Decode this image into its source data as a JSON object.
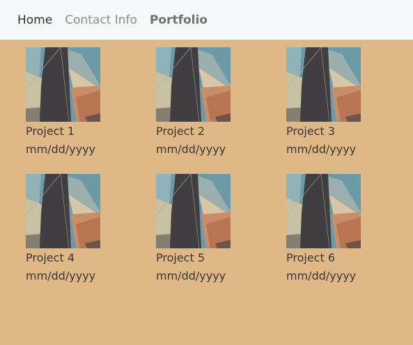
{
  "nav": {
    "home": "Home",
    "contact": "Contact Info",
    "portfolio": "Portfolio"
  },
  "projects": [
    {
      "title": "Project 1",
      "date": "mm/dd/yyyy"
    },
    {
      "title": "Project 2",
      "date": "mm/dd/yyyy"
    },
    {
      "title": "Project 3",
      "date": "mm/dd/yyyy"
    },
    {
      "title": "Project 4",
      "date": "mm/dd/yyyy"
    },
    {
      "title": "Project 5",
      "date": "mm/dd/yyyy"
    },
    {
      "title": "Project 6",
      "date": "mm/dd/yyyy"
    }
  ],
  "colors": {
    "background": "#DEB887",
    "navbar": "#F6F8FA"
  }
}
